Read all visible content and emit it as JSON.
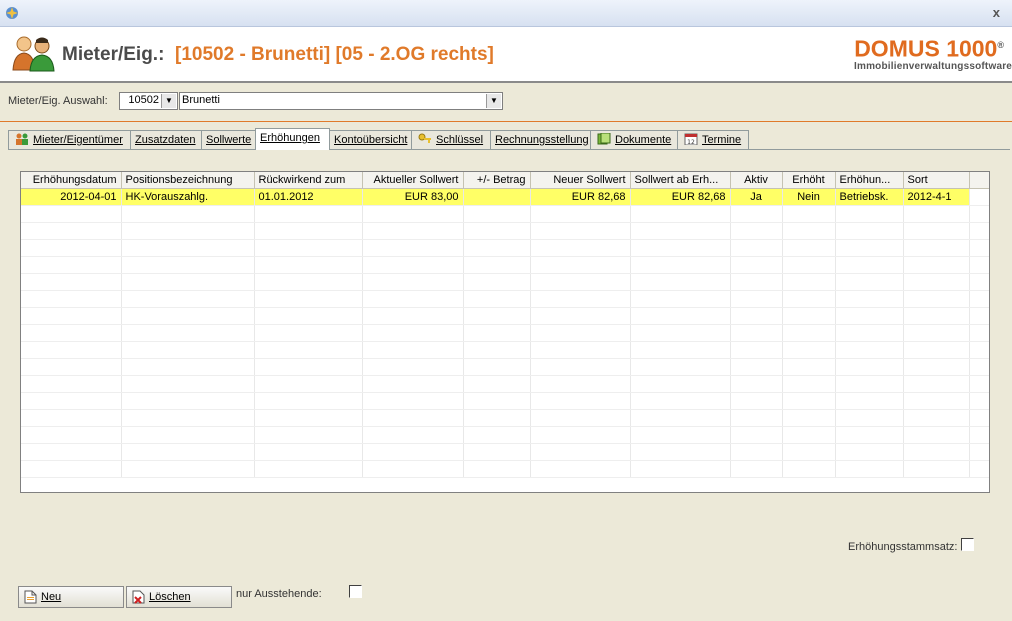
{
  "window": {
    "close_label": "x"
  },
  "header": {
    "title_label": "Mieter/Eig.:",
    "title_value": "[10502 - Brunetti] [05 - 2.OG rechts]",
    "logo_line1": "DOMUS 1000",
    "logo_reg": "®",
    "logo_line2": "Immobilienverwaltungssoftware"
  },
  "selector": {
    "label": "Mieter/Eig. Auswahl:",
    "id_value": "10502",
    "name_value": "Brunetti"
  },
  "tabs": [
    {
      "label": "Mieter/Eigentümer",
      "icon": "people-icon"
    },
    {
      "label": "Zusatzdaten"
    },
    {
      "label": "Sollwerte"
    },
    {
      "label": "Erhöhungen",
      "active": true
    },
    {
      "label": "Kontoübersicht"
    },
    {
      "label": "Schlüssel",
      "icon": "key-icon"
    },
    {
      "label": "Rechnungsstellung"
    },
    {
      "label": "Dokumente",
      "icon": "documents-icon"
    },
    {
      "label": "Termine",
      "icon": "calendar-icon"
    }
  ],
  "table": {
    "columns": [
      "Erhöhungsdatum",
      "Positionsbezeichnung",
      "Rückwirkend zum",
      "Aktueller Sollwert",
      "+/- Betrag",
      "Neuer Sollwert",
      "Sollwert ab Erh...",
      "Aktiv",
      "Erhöht",
      "Erhöhun...",
      "Sort"
    ],
    "rows": [
      [
        "2012-04-01",
        "HK-Vorauszahlg.",
        "01.01.2012",
        "EUR 83,00",
        "",
        "EUR 82,68",
        "EUR 82,68",
        "Ja",
        "Nein",
        "Betriebsk.",
        "2012-4-1"
      ]
    ]
  },
  "controls": {
    "stammsatz_label": "Erhöhungsstammsatz:",
    "neu_label": "Neu",
    "loeschen_label": "Löschen",
    "ausstehende_label": "nur Ausstehende:"
  },
  "colors": {
    "accent": "#e07a2a",
    "selected_row": "#ffff66"
  }
}
